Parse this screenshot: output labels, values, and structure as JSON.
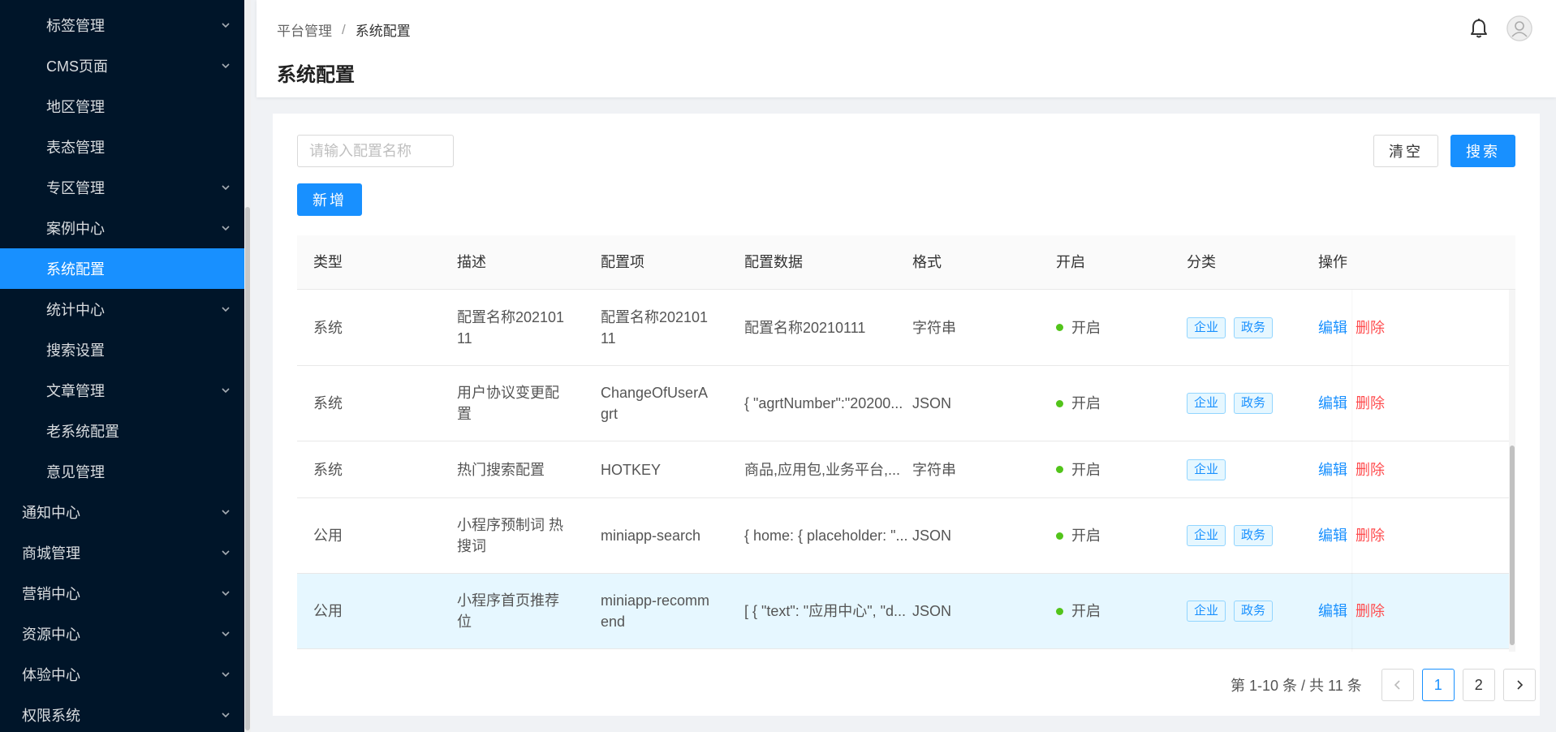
{
  "sidebar": {
    "items": [
      {
        "label": "标签管理",
        "arrow": true,
        "level": "sub"
      },
      {
        "label": "CMS页面",
        "arrow": true,
        "level": "sub"
      },
      {
        "label": "地区管理",
        "arrow": false,
        "level": "sub"
      },
      {
        "label": "表态管理",
        "arrow": false,
        "level": "sub"
      },
      {
        "label": "专区管理",
        "arrow": true,
        "level": "sub"
      },
      {
        "label": "案例中心",
        "arrow": true,
        "level": "sub"
      },
      {
        "label": "系统配置",
        "arrow": false,
        "level": "sub",
        "active": true
      },
      {
        "label": "统计中心",
        "arrow": true,
        "level": "sub"
      },
      {
        "label": "搜索设置",
        "arrow": false,
        "level": "sub"
      },
      {
        "label": "文章管理",
        "arrow": true,
        "level": "sub"
      },
      {
        "label": "老系统配置",
        "arrow": false,
        "level": "sub"
      },
      {
        "label": "意见管理",
        "arrow": false,
        "level": "sub"
      },
      {
        "label": "通知中心",
        "arrow": true,
        "level": "top"
      },
      {
        "label": "商城管理",
        "arrow": true,
        "level": "top"
      },
      {
        "label": "营销中心",
        "arrow": true,
        "level": "top"
      },
      {
        "label": "资源中心",
        "arrow": true,
        "level": "top"
      },
      {
        "label": "体验中心",
        "arrow": true,
        "level": "top"
      },
      {
        "label": "权限系统",
        "arrow": true,
        "level": "top"
      }
    ]
  },
  "header": {
    "breadcrumb": [
      "平台管理",
      "系统配置"
    ],
    "breadcrumb_sep": "/",
    "title": "系统配置",
    "icons": [
      "bell-icon",
      "user-avatar-icon"
    ]
  },
  "toolbar": {
    "search_placeholder": "请输入配置名称",
    "search_value": "",
    "clear_label": "清空",
    "search_label": "搜索",
    "add_label": "新增"
  },
  "table": {
    "columns": [
      "类型",
      "描述",
      "配置项",
      "配置数据",
      "格式",
      "开启",
      "分类",
      "操作"
    ],
    "rows": [
      {
        "type": "系统",
        "desc": "配置名称20210111",
        "key": "配置名称20210111",
        "data": "配置名称20210111",
        "format": "字符串",
        "status": "开启",
        "tags": [
          "企业",
          "政务"
        ],
        "edit": "编辑",
        "delete": "删除"
      },
      {
        "type": "系统",
        "desc": "用户协议变更配置",
        "key": "ChangeOfUserAgrt",
        "data": "{ \"agrtNumber\":\"20200...",
        "format": "JSON",
        "status": "开启",
        "tags": [
          "企业",
          "政务"
        ],
        "edit": "编辑",
        "delete": "删除"
      },
      {
        "type": "系统",
        "desc": "热门搜索配置",
        "key": "HOTKEY",
        "data": "商品,应用包,业务平台,...",
        "format": "字符串",
        "status": "开启",
        "tags": [
          "企业"
        ],
        "edit": "编辑",
        "delete": "删除"
      },
      {
        "type": "公用",
        "desc": "小程序预制词 热搜词",
        "key": "miniapp-search",
        "data": "{ home: { placeholder: \"...",
        "format": "JSON",
        "status": "开启",
        "tags": [
          "企业",
          "政务"
        ],
        "edit": "编辑",
        "delete": "删除"
      },
      {
        "type": "公用",
        "desc": "小程序首页推荐位",
        "key": "miniapp-recommend",
        "data": "[ { \"text\": \"应用中心\", \"d...",
        "format": "JSON",
        "status": "开启",
        "tags": [
          "企业",
          "政务"
        ],
        "edit": "编辑",
        "delete": "删除",
        "highlight": true
      }
    ]
  },
  "pagination": {
    "total_text": "第 1-10 条 / 共 11 条",
    "prev": "<",
    "pages": [
      "1",
      "2"
    ],
    "current": "1",
    "next": ">"
  },
  "colors": {
    "sidebar_bg": "#001529",
    "accent": "#1890ff",
    "danger": "#ff4d4f",
    "success": "#52c41a"
  }
}
